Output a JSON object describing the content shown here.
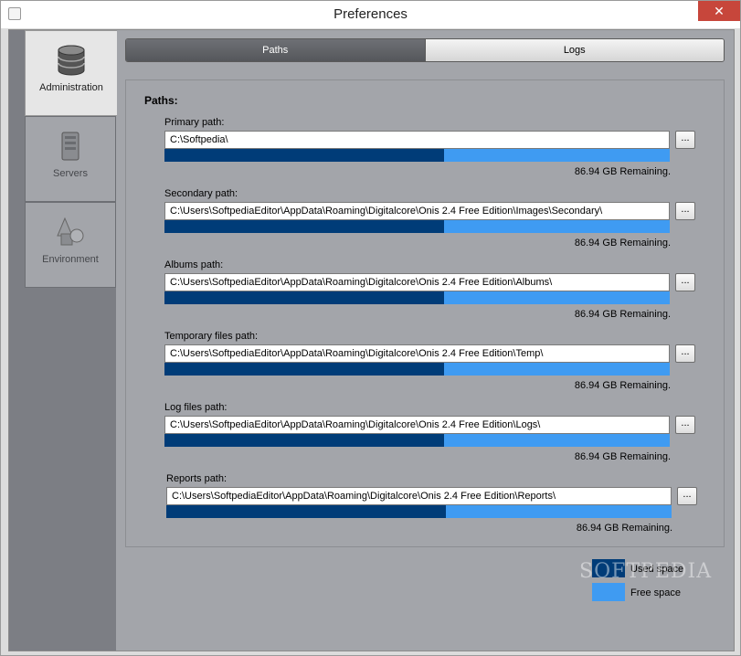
{
  "window": {
    "title": "Preferences",
    "close_label": "✕"
  },
  "sidebar": {
    "items": [
      {
        "label": "Administration",
        "active": true
      },
      {
        "label": "Servers",
        "active": false
      },
      {
        "label": "Environment",
        "active": false
      }
    ]
  },
  "tabs": [
    {
      "label": "Paths",
      "active": true
    },
    {
      "label": "Logs",
      "active": false
    }
  ],
  "paths": {
    "title": "Paths:",
    "browse_label": "...",
    "rows": [
      {
        "label": "Primary path:",
        "value": "C:\\Softpedia\\",
        "used_fraction": 0.553,
        "remaining": "86.94 GB Remaining."
      },
      {
        "label": "Secondary path:",
        "value": "C:\\Users\\SoftpediaEditor\\AppData\\Roaming\\Digitalcore\\Onis 2.4 Free Edition\\Images\\Secondary\\",
        "used_fraction": 0.553,
        "remaining": "86.94 GB Remaining."
      },
      {
        "label": "Albums path:",
        "value": "C:\\Users\\SoftpediaEditor\\AppData\\Roaming\\Digitalcore\\Onis 2.4 Free Edition\\Albums\\",
        "used_fraction": 0.553,
        "remaining": "86.94 GB Remaining."
      },
      {
        "label": "Temporary files path:",
        "value": "C:\\Users\\SoftpediaEditor\\AppData\\Roaming\\Digitalcore\\Onis 2.4 Free Edition\\Temp\\",
        "used_fraction": 0.553,
        "remaining": "86.94 GB Remaining."
      },
      {
        "label": "Log files path:",
        "value": "C:\\Users\\SoftpediaEditor\\AppData\\Roaming\\Digitalcore\\Onis 2.4 Free Edition\\Logs\\",
        "used_fraction": 0.553,
        "remaining": "86.94 GB Remaining."
      },
      {
        "label": "Reports path:",
        "value": "C:\\Users\\SoftpediaEditor\\AppData\\Roaming\\Digitalcore\\Onis 2.4 Free Edition\\Reports\\",
        "used_fraction": 0.553,
        "remaining": "86.94 GB Remaining."
      }
    ]
  },
  "legend": {
    "used_label": "Used space",
    "free_label": "Free space",
    "used_color": "#003c78",
    "free_color": "#3f9bf2"
  },
  "watermark": "SOFTPEDIA"
}
